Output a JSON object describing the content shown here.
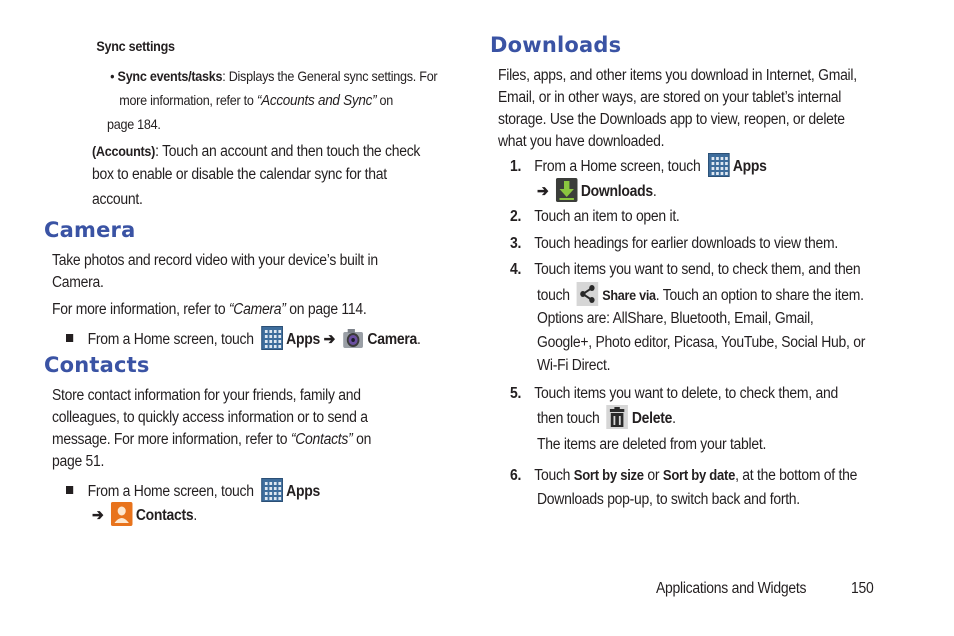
{
  "left": {
    "sync_settings": {
      "title": "Sync settings",
      "bullet_bold": "Sync events/tasks",
      "bullet_text": ": Displays the General sync settings. For",
      "bullet_line2_pre": "more information, refer to ",
      "bullet_ref": "“Accounts and Sync”",
      "bullet_line2_post": " on",
      "bullet_line3": "page 184.",
      "accounts_bold": "(Accounts)",
      "accounts_line1": ": Touch an account and then touch the check",
      "accounts_line2": "box to enable or disable the calendar sync for that",
      "accounts_line3": "account."
    },
    "camera": {
      "heading": "Camera",
      "line1": "Take photos and record video with your device’s built in",
      "line2": "Camera.",
      "ref_pre": "For more information, refer to ",
      "ref": "“Camera”",
      "ref_post": " on page 114.",
      "step_pre": "From a Home screen, touch",
      "apps": "Apps",
      "arrow": "➔",
      "target": "Camera",
      "period": "."
    },
    "contacts": {
      "heading": "Contacts",
      "line1": "Store contact information for your friends, family and",
      "line2": "colleagues, to quickly access information or to send a",
      "line3_pre": "message. For more information, refer to ",
      "line3_ref": "“Contacts”",
      "line3_post": " on",
      "line4": "page 51.",
      "step_pre": "From a Home screen, touch",
      "apps": "Apps",
      "arrow": "➔",
      "target": "Contacts",
      "period": "."
    }
  },
  "right": {
    "heading": "Downloads",
    "intro": [
      "Files, apps, and other items you download in Internet, Gmail,",
      "Email, or in other ways, are stored on your tablet’s internal",
      "storage. Use the Downloads app to view, reopen, or delete",
      "what you have downloaded."
    ],
    "steps": {
      "s1": {
        "num": "1.",
        "pre": "From a Home screen, touch",
        "apps": "Apps",
        "arrow": "➔",
        "target": "Downloads",
        "period": "."
      },
      "s2": {
        "num": "2.",
        "text": "Touch an item to open it."
      },
      "s3": {
        "num": "3.",
        "text": "Touch headings for earlier downloads to view them."
      },
      "s4": {
        "num": "4.",
        "line1": "Touch items you want to send, to check them, and then",
        "line2_pre": "touch",
        "share": "Share via",
        "line2_post": ". Touch an option to share the item.",
        "line3": "Options are: AllShare, Bluetooth, Email, Gmail,",
        "line4": "Google+, Photo editor, Picasa, YouTube, Social Hub, or",
        "line5": "Wi-Fi Direct."
      },
      "s5": {
        "num": "5.",
        "line1": "Touch items you want to delete, to check them, and",
        "line2_pre": "then touch",
        "delete": "Delete",
        "period": ".",
        "note": "The items are deleted from your tablet."
      },
      "s6": {
        "num": "6.",
        "pre": "Touch ",
        "b1": "Sort by size",
        "mid": " or ",
        "b2": "Sort by date",
        "post": ", at the bottom of the",
        "line2": "Downloads pop-up, to switch back and forth."
      }
    }
  },
  "footer": {
    "section": "Applications and Widgets",
    "page": "150"
  },
  "colors": {
    "heading": "#3a53a4",
    "text": "#231f20"
  }
}
